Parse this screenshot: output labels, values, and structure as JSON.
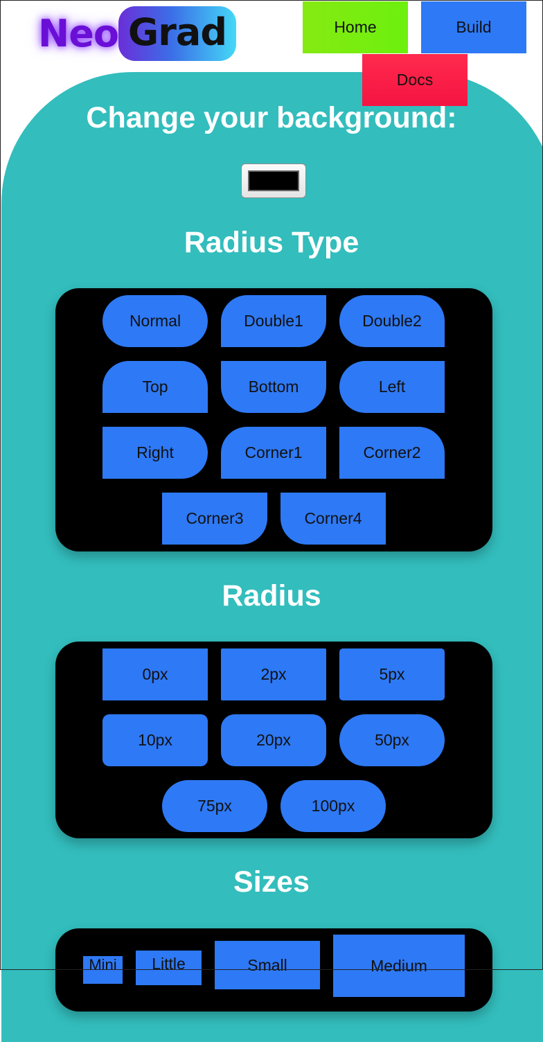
{
  "brand": {
    "neo": "Neo",
    "grad": "Grad"
  },
  "nav": {
    "home": "Home",
    "build": "Build",
    "docs": "Docs"
  },
  "background": {
    "heading": "Change your background:",
    "color_value": "#000000"
  },
  "radius_type": {
    "heading": "Radius Type",
    "options": [
      "Normal",
      "Double1",
      "Double2",
      "Top",
      "Bottom",
      "Left",
      "Right",
      "Corner1",
      "Corner2",
      "Corner3",
      "Corner4"
    ]
  },
  "radius": {
    "heading": "Radius",
    "options": [
      "0px",
      "2px",
      "5px",
      "10px",
      "20px",
      "50px",
      "75px",
      "100px"
    ]
  },
  "sizes": {
    "heading": "Sizes",
    "options": [
      "Mini",
      "Little",
      "Small",
      "Medium"
    ]
  },
  "colors": {
    "teal": "#33bdbd",
    "button_blue": "#2e79f5",
    "home_green": "#6cf00e",
    "docs_red": "#f51442"
  }
}
